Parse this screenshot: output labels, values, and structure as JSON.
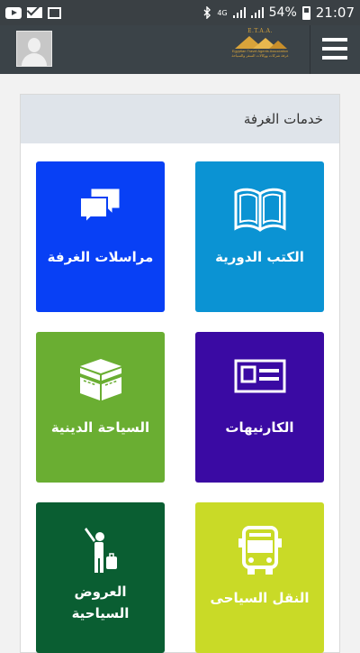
{
  "status_bar": {
    "bluetooth_icon": "bluetooth-icon",
    "network": "4G",
    "battery_percent": "54%",
    "time": "21:07"
  },
  "header": {
    "logo": {
      "abbr": "E.T.A.A.",
      "name_en": "Egyptian Travel Agents Association",
      "name_ar": "غرفة شركات ووكالات السفر والسياحة"
    },
    "menu_icon": "hamburger-icon"
  },
  "section": {
    "title": "خدمات الغرفة"
  },
  "tiles": [
    {
      "label": "الكتب الدورية",
      "icon": "book-icon",
      "color": "#0b93d3"
    },
    {
      "label": "مراسلات الغرفة",
      "icon": "chat-bubbles-icon",
      "color": "#0840f5"
    },
    {
      "label": "الكارنيهات",
      "icon": "id-card-icon",
      "color": "#3a0aa3"
    },
    {
      "label": "السياحة الدينية",
      "icon": "kaaba-icon",
      "color": "#6aae32"
    },
    {
      "label": "النقل السياحى",
      "icon": "bus-icon",
      "color": "#c9da27"
    },
    {
      "label_line1": "العروض",
      "label_line2": "السياحية",
      "icon": "traveler-icon",
      "color": "#0a5e32"
    }
  ]
}
